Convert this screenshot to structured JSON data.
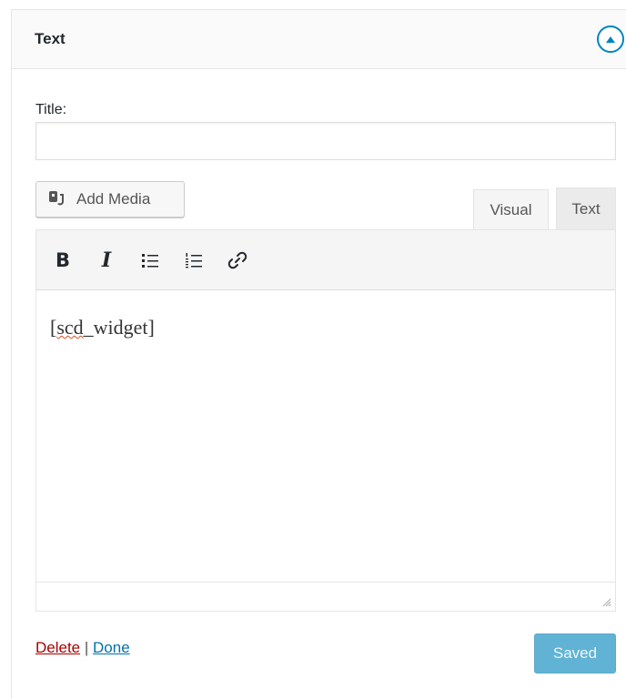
{
  "widget": {
    "title": "Text",
    "toggle_icon": "arrow-up-icon"
  },
  "form": {
    "title_label": "Title:",
    "title_value": "",
    "add_media_label": "Add Media",
    "tabs": [
      {
        "label": "Visual",
        "active": true
      },
      {
        "label": "Text",
        "active": false
      }
    ],
    "toolbar": {
      "bold": "B",
      "italic": "I",
      "icons": [
        "bold-icon",
        "italic-icon",
        "bulleted-list-icon",
        "numbered-list-icon",
        "link-icon"
      ]
    },
    "content": "[scd_widget]",
    "content_prefix": "[",
    "content_misspelled": "scd",
    "content_suffix": "_widget]"
  },
  "actions": {
    "delete_label": "Delete",
    "separator": "|",
    "done_label": "Done",
    "saved_label": "Saved"
  },
  "colors": {
    "accent": "#0085ba",
    "delete": "#a00000",
    "link": "#0073aa"
  }
}
